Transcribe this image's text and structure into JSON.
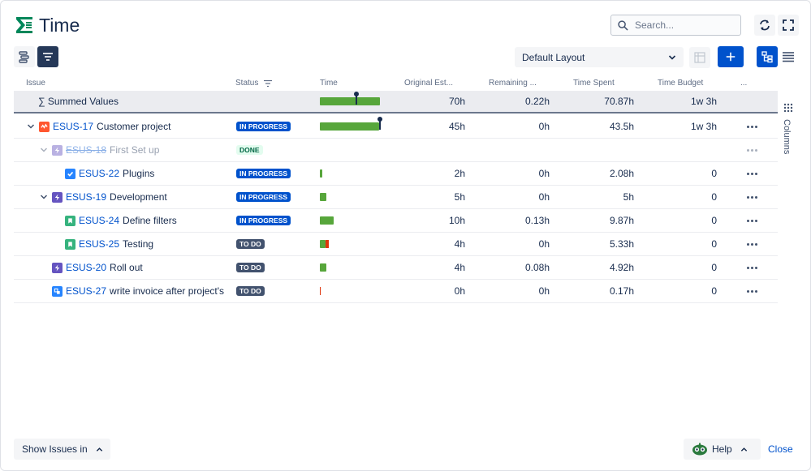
{
  "app": {
    "title": "Time"
  },
  "search": {
    "placeholder": "Search..."
  },
  "toolbar": {
    "layout_label": "Default Layout"
  },
  "columns": {
    "issue": "Issue",
    "status": "Status",
    "time": "Time",
    "original_estimate": "Original Est...",
    "remaining": "Remaining ...",
    "time_spent": "Time Spent",
    "time_budget": "Time Budget",
    "more": "..."
  },
  "side_panel": {
    "columns_label": "Columns"
  },
  "summed": {
    "label": "∑ Summed Values",
    "time_progress": 0.99,
    "original_estimate": "70h",
    "remaining": "0.22h",
    "time_spent": "70.87h",
    "time_budget": "1w 3h"
  },
  "rows": [
    {
      "indent": 1,
      "chevron": true,
      "type": "epic",
      "key": "ESUS-17",
      "summary": "Customer project",
      "status": "IN PROGRESS",
      "status_kind": "progress",
      "done": false,
      "time_progress": 0.97,
      "time_over": 0,
      "pin": true,
      "original_estimate": "45h",
      "remaining": "0h",
      "time_spent": "43.5h",
      "time_budget": "1w 3h"
    },
    {
      "indent": 2,
      "chevron": true,
      "type": "story-purple",
      "key": "ESUS-18",
      "summary": "First Set up",
      "status": "DONE",
      "status_kind": "done",
      "done": true,
      "time_progress": 0,
      "time_over": 0,
      "pin": false,
      "original_estimate": "",
      "remaining": "",
      "time_spent": "",
      "time_budget": ""
    },
    {
      "indent": 3,
      "chevron": false,
      "type": "task",
      "key": "ESUS-22",
      "summary": "Plugins",
      "status": "IN PROGRESS",
      "status_kind": "progress",
      "done": false,
      "time_progress": 0.04,
      "time_over": 0,
      "pin": false,
      "original_estimate": "2h",
      "remaining": "0h",
      "time_spent": "2.08h",
      "time_budget": "0"
    },
    {
      "indent": 2,
      "chevron": true,
      "type": "story-purple",
      "key": "ESUS-19",
      "summary": "Development",
      "status": "IN PROGRESS",
      "status_kind": "progress",
      "done": false,
      "time_progress": 0.11,
      "time_over": 0,
      "pin": false,
      "original_estimate": "5h",
      "remaining": "0h",
      "time_spent": "5h",
      "time_budget": "0"
    },
    {
      "indent": 3,
      "chevron": false,
      "type": "story",
      "key": "ESUS-24",
      "summary": "Define filters",
      "status": "IN PROGRESS",
      "status_kind": "progress",
      "done": false,
      "time_progress": 0.22,
      "time_over": 0,
      "pin": false,
      "original_estimate": "10h",
      "remaining": "0.13h",
      "time_spent": "9.87h",
      "time_budget": "0"
    },
    {
      "indent": 3,
      "chevron": false,
      "type": "story",
      "key": "ESUS-25",
      "summary": "Testing",
      "status": "TO DO",
      "status_kind": "todo",
      "done": false,
      "time_progress": 0.09,
      "time_over": 0.05,
      "pin": false,
      "original_estimate": "4h",
      "remaining": "0h",
      "time_spent": "5.33h",
      "time_budget": "0"
    },
    {
      "indent": 2,
      "chevron": false,
      "type": "story-purple",
      "key": "ESUS-20",
      "summary": "Roll out",
      "status": "TO DO",
      "status_kind": "todo",
      "done": false,
      "time_progress": 0.11,
      "time_over": 0,
      "pin": false,
      "original_estimate": "4h",
      "remaining": "0.08h",
      "time_spent": "4.92h",
      "time_budget": "0"
    },
    {
      "indent": 2,
      "chevron": false,
      "type": "subtask",
      "key": "ESUS-27",
      "summary": "write invoice after project's",
      "status": "TO DO",
      "status_kind": "todo",
      "done": false,
      "time_progress": 0,
      "time_over": 0.01,
      "pin": false,
      "original_estimate": "0h",
      "remaining": "0h",
      "time_spent": "0.17h",
      "time_budget": "0"
    }
  ],
  "footer": {
    "show_issues_label": "Show Issues in",
    "help_label": "Help",
    "close_label": "Close"
  },
  "colors": {
    "accent": "#0052cc",
    "bar_green": "#57a63b",
    "bar_red": "#de350b",
    "epic": "#ff5630",
    "purple": "#6554c0",
    "story": "#36b37e",
    "task": "#2684ff"
  }
}
